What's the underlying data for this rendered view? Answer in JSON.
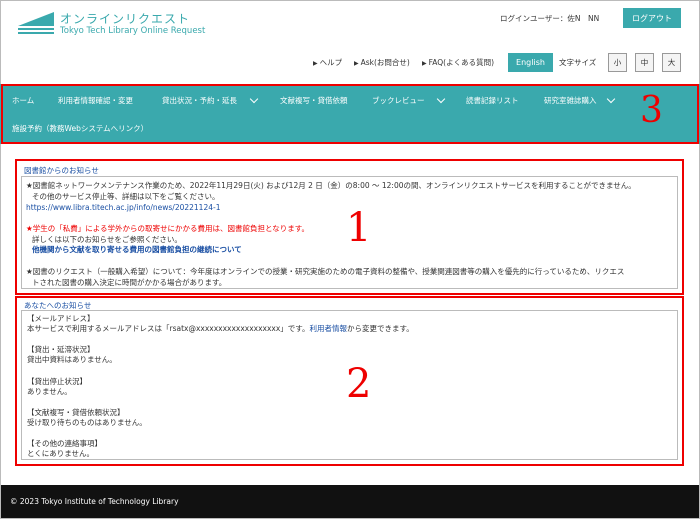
{
  "header": {
    "logo_jp": "オンラインリクエスト",
    "logo_en": "Tokyo Tech Library Online Request",
    "user_line": "ログインユーザー：佐N　NN",
    "logout": "ログアウト",
    "util_links": [
      "ヘルプ",
      "Ask(お問合せ)",
      "FAQ(よくある質問)"
    ],
    "english": "English",
    "font_size_label": "文字サイズ",
    "font_sizes": [
      "小",
      "中",
      "大"
    ]
  },
  "nav": {
    "items": [
      "ホーム",
      "利用者情報確認・変更",
      "貸出状況・予約・延長",
      "文献複写・貸借依頼",
      "ブックレビュー",
      "読書記録リスト",
      "研究室雑誌購入",
      "施設予約（教務Webシステムへリンク）"
    ],
    "callout": "3"
  },
  "library_notice": {
    "title": "図書館からのお知らせ",
    "callout": "1",
    "lines": [
      "★図書館ネットワークメンテナンス作業のため、2022年11月29日(火) および12月 2 日（金）の8:00 ～ 12:00の間、オンラインリクエストサービスを利用することができません。",
      "その他のサービス停止等、詳細は以下をご覧ください。",
      "https://www.libra.titech.ac.jp/info/news/20221124-1",
      "★学生の「私費」による学外からの取寄せにかかる費用は、図書館負担となります。",
      "詳しくは以下のお知らせをご参照ください。",
      "他機関から文献を取り寄せる費用の図書館負担の継続について",
      "★図書のリクエスト（一般購入希望）について：今年度はオンラインでの授業・研究実施のための電子資料の整備や、授業関連図書等の購入を優先的に行っているため、リクエス",
      "トされた図書の購入決定に時間がかかる場合があります。"
    ]
  },
  "user_notice": {
    "title": "あなたへのお知らせ",
    "callout": "2",
    "mail_heading": "【メールアドレス】",
    "mail_prefix": "本サービスで利用するメールアドレスは「rsatx@xxxxxxxxxxxxxxxxxxx」です。",
    "mail_link": "利用者情報",
    "mail_suffix": "から変更できます。",
    "sections": [
      {
        "heading": "【貸出・延滞状況】",
        "text": "貸出中資料はありません。"
      },
      {
        "heading": "【貸出停止状況】",
        "text": "ありません。"
      },
      {
        "heading": "【文献複写・貸借依頼状況】",
        "text": "受け取り待ちのものはありません。"
      },
      {
        "heading": "【その他の連絡事項】",
        "text": "とくにありません。"
      }
    ]
  },
  "footer": {
    "copyright": "© 2023 Tokyo Institute of Technology Library"
  },
  "colors": {
    "accent": "#3aa9ad",
    "callout": "#e00000",
    "link": "#1a4fa3"
  }
}
